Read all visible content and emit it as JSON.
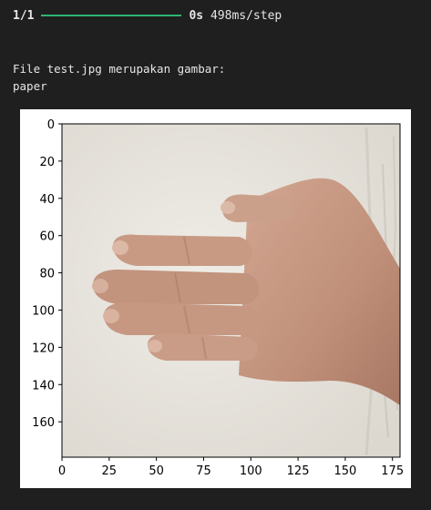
{
  "progress": {
    "step_count": "1/1",
    "fraction": 1.0,
    "time_bold": "0s",
    "time_rest": "498ms/step"
  },
  "output": {
    "line1": "File test.jpg merupakan gambar:",
    "line2": "paper"
  },
  "plot": {
    "x_ticks": [
      "0",
      "25",
      "50",
      "75",
      "100",
      "125",
      "150",
      "175"
    ],
    "y_ticks": [
      "0",
      "20",
      "40",
      "60",
      "80",
      "100",
      "120",
      "140",
      "160"
    ],
    "x_range": [
      0,
      179
    ],
    "y_range": [
      0,
      179
    ]
  },
  "colors": {
    "progress_fill": "#2bb673",
    "background": "#1f1f1f"
  }
}
